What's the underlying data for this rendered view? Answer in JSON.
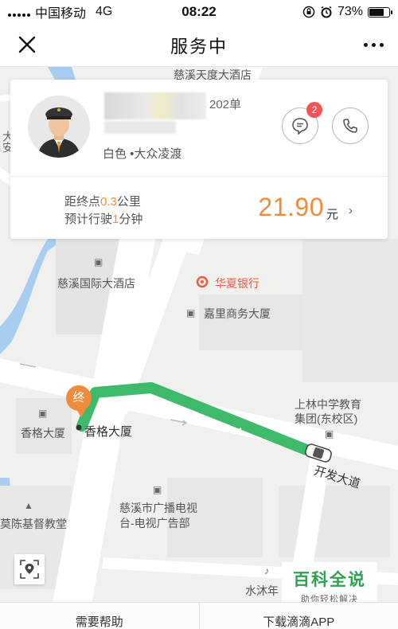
{
  "status_bar": {
    "carrier": "中国移动",
    "network": "4G",
    "time": "08:22",
    "battery_percent": "73%",
    "battery_level": 0.73,
    "icons": [
      "signal-icon",
      "rotation-lock-icon",
      "alarm-icon",
      "battery-icon"
    ]
  },
  "nav": {
    "title": "服务中",
    "close_icon": "close-icon",
    "more_icon": "more-icon"
  },
  "driver": {
    "order_count": "202单",
    "car": "白色 •大众凌渡",
    "unread_messages": "2"
  },
  "trip": {
    "distance_prefix": "距终点",
    "distance_value": "0.3",
    "distance_unit": "公里",
    "eta_prefix": "预计行驶",
    "eta_value": "1",
    "eta_unit": "分钟",
    "fare": "21.90",
    "fare_unit": "元",
    "fare_arrow": "›"
  },
  "map": {
    "destination_marker": "终",
    "labels": {
      "hotel_top": "慈溪天度大酒店",
      "hotel_intl": "慈溪国际大酒店",
      "bank": "华夏银行",
      "jiali": "嘉里商务大厦",
      "school": "上林中学教育",
      "school2": "集团(东校区)",
      "xiangge_left": "香格大厦",
      "xiangge_dest": "香格大厦",
      "road": "开发大道",
      "tv1": "慈溪市广播电视",
      "tv2": "台-电视广告部",
      "church": "莫陈基督教堂",
      "shuimu": "水沐年",
      "left_vertical": "大安"
    },
    "route_color": "#3dbb6b",
    "marker_color": "#f08d3c",
    "bank_color": "#f05a3c"
  },
  "bottom": {
    "help": "需要帮助",
    "download": "下载滴滴APP"
  },
  "watermark": {
    "title": "百科全说",
    "subtitle": "助你轻松解决"
  }
}
